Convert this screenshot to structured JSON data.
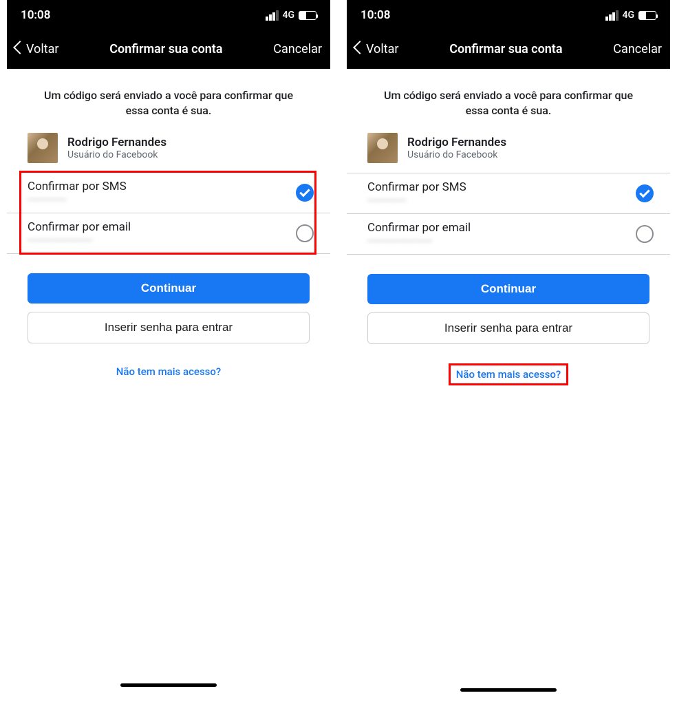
{
  "status": {
    "time": "10:08",
    "network": "4G"
  },
  "nav": {
    "back": "Voltar",
    "title": "Confirmar sua conta",
    "cancel": "Cancelar"
  },
  "subtitle": "Um código será enviado a você para confirmar que essa conta é sua.",
  "user": {
    "name": "Rodrigo Fernandes",
    "subtitle": "Usuário do Facebook"
  },
  "options": [
    {
      "title": "Confirmar por SMS",
      "value_masked": "••••••••••••",
      "selected": true
    },
    {
      "title": "Confirmar por email",
      "value_masked": "••••••••••••••••••••",
      "selected": false
    }
  ],
  "buttons": {
    "continue": "Continuar",
    "password": "Inserir senha para entrar",
    "no_access": "Não tem mais acesso?"
  },
  "highlights": {
    "left_panel": "options",
    "right_panel": "no_access_link"
  }
}
